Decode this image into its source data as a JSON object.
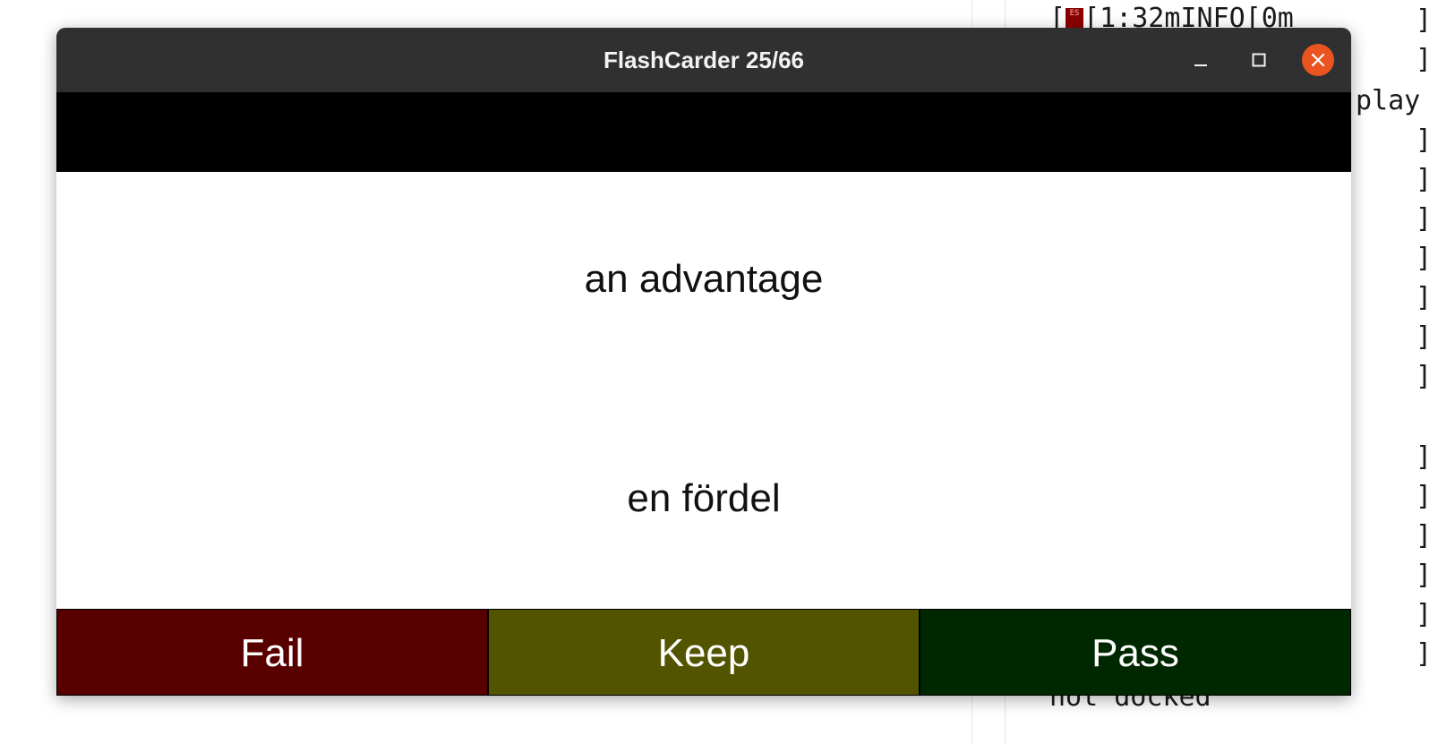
{
  "window": {
    "title": "FlashCarder 25/66"
  },
  "card": {
    "front": "an advantage",
    "back": "en fördel"
  },
  "buttons": {
    "fail": "Fail",
    "keep": "Keep",
    "pass": "Pass"
  },
  "colors": {
    "fail": "#580000",
    "keep": "#535400",
    "pass": "#002800",
    "close_button": "#e95420",
    "titlebar": "#303030"
  },
  "background_terminal": {
    "line1": "[1:32mINFO[0m",
    "line3": "play",
    "bottom_line": "not docked"
  },
  "icons": {
    "minimize": "minimize-icon",
    "maximize": "maximize-icon",
    "close": "close-icon"
  }
}
